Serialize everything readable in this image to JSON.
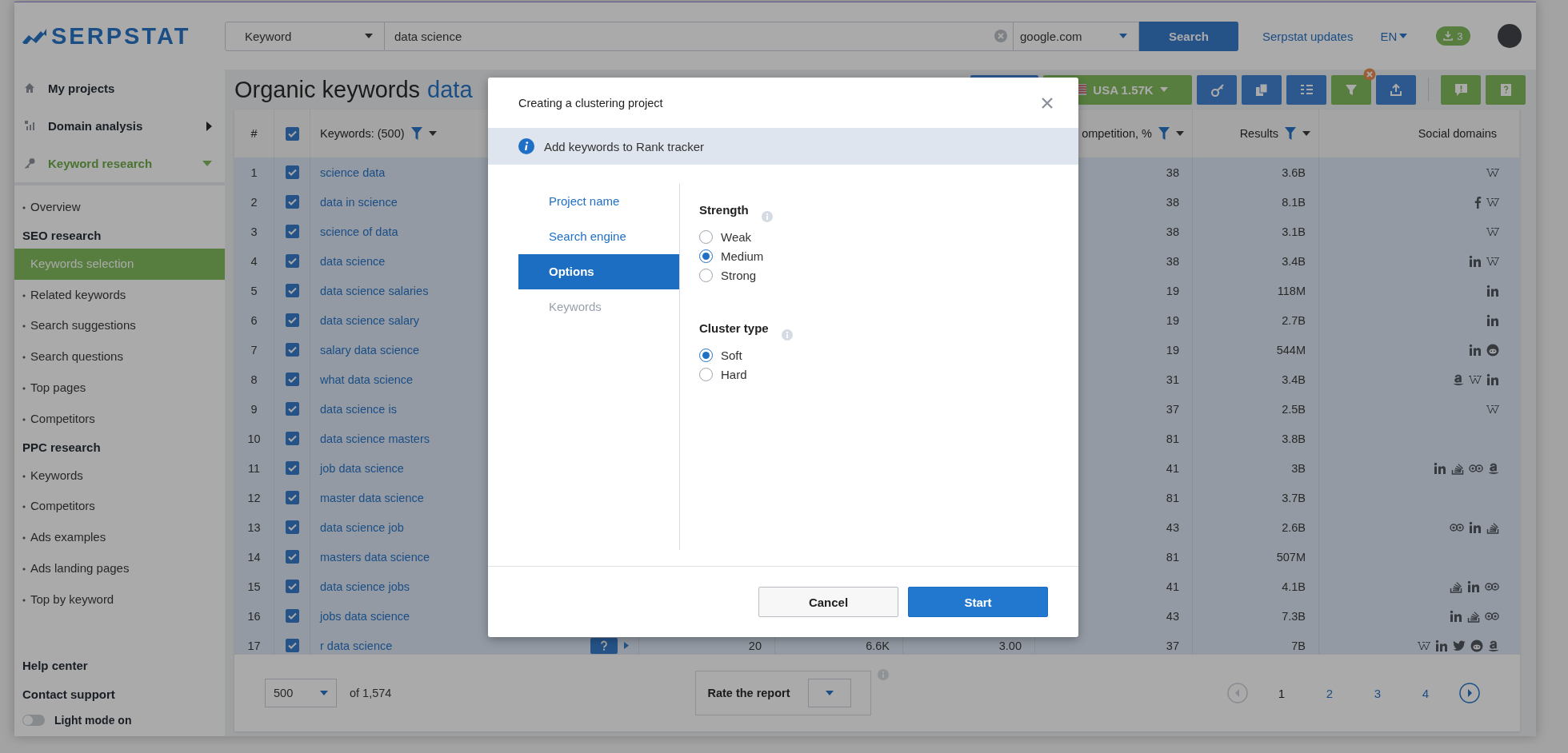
{
  "header": {
    "logo": "SERPSTAT",
    "search_type": "Keyword",
    "query": "data science",
    "engine": "google.com",
    "search_button": "Search",
    "updates_link": "Serpstat updates",
    "language": "EN",
    "downloads": "3"
  },
  "sidebar": {
    "items": [
      {
        "label": "My projects",
        "kind": "link"
      },
      {
        "label": "Domain analysis",
        "kind": "menu",
        "expanded": false
      },
      {
        "label": "Keyword research",
        "kind": "menu",
        "expanded": true
      }
    ],
    "subitems": [
      {
        "label": "Overview",
        "kind": "link",
        "selected": false
      },
      {
        "label": "SEO research",
        "kind": "heading"
      },
      {
        "label": "Keywords selection",
        "kind": "link",
        "selected": true
      },
      {
        "label": "Related keywords",
        "kind": "link",
        "selected": false
      },
      {
        "label": "Search suggestions",
        "kind": "link",
        "selected": false
      },
      {
        "label": "Search questions",
        "kind": "link",
        "selected": false
      },
      {
        "label": "Top pages",
        "kind": "link",
        "selected": false
      },
      {
        "label": "Competitors",
        "kind": "link",
        "selected": false
      },
      {
        "label": "PPC research",
        "kind": "heading"
      },
      {
        "label": "Keywords",
        "kind": "link",
        "selected": false
      },
      {
        "label": "Competitors",
        "kind": "link",
        "selected": false
      },
      {
        "label": "Ads examples",
        "kind": "link",
        "selected": false
      },
      {
        "label": "Ads landing pages",
        "kind": "link",
        "selected": false
      },
      {
        "label": "Top by keyword",
        "kind": "link",
        "selected": false
      }
    ],
    "footer_links": [
      "Help center",
      "Contact support"
    ],
    "toggle": {
      "label": "Light mode on",
      "on": false
    }
  },
  "page": {
    "title": "Organic keywords",
    "query": "data"
  },
  "toolbar": [
    {
      "kind": "plain"
    },
    {
      "kind": "country",
      "label": "USA 1.57K"
    },
    {
      "kind": "key"
    },
    {
      "kind": "copy"
    },
    {
      "kind": "columns"
    },
    {
      "kind": "filter",
      "active": true
    },
    {
      "kind": "export"
    },
    {
      "kind": "feedback"
    },
    {
      "kind": "help"
    }
  ],
  "table": {
    "header_checked": true,
    "columns": [
      {
        "label": "#",
        "filter": false
      },
      {
        "label": "Keywords: (500)",
        "filter": true
      },
      {
        "label": "ompetition, %",
        "filter": true
      },
      {
        "label": "Results",
        "filter": true
      },
      {
        "label": "Social domains",
        "filter": false
      }
    ],
    "rows": [
      {
        "num": "1",
        "checked": true,
        "keyword": "science data",
        "competition": "38",
        "results": "3.6B",
        "social": [
          {
            "kind": "wikipedia"
          }
        ]
      },
      {
        "num": "2",
        "checked": true,
        "keyword": "data in science",
        "competition": "38",
        "results": "8.1B",
        "social": [
          {
            "kind": "facebook"
          },
          {
            "kind": "wikipedia"
          }
        ]
      },
      {
        "num": "3",
        "checked": true,
        "keyword": "science of data",
        "competition": "38",
        "results": "3.1B",
        "social": [
          {
            "kind": "wikipedia"
          }
        ]
      },
      {
        "num": "4",
        "checked": true,
        "keyword": "data science",
        "competition": "38",
        "results": "3.4B",
        "social": [
          {
            "kind": "linkedin"
          },
          {
            "kind": "wikipedia"
          }
        ]
      },
      {
        "num": "5",
        "checked": true,
        "keyword": "data science salaries",
        "competition": "19",
        "results": "118M",
        "social": [
          {
            "kind": "linkedin"
          }
        ]
      },
      {
        "num": "6",
        "checked": true,
        "keyword": "data science salary",
        "competition": "19",
        "results": "2.7B",
        "social": [
          {
            "kind": "linkedin"
          }
        ]
      },
      {
        "num": "7",
        "checked": true,
        "keyword": "salary data science",
        "competition": "19",
        "results": "544M",
        "social": [
          {
            "kind": "linkedin"
          },
          {
            "kind": "reddit"
          }
        ]
      },
      {
        "num": "8",
        "checked": true,
        "keyword": "what data science",
        "competition": "31",
        "results": "3.4B",
        "social": [
          {
            "kind": "amazon"
          },
          {
            "kind": "wikipedia"
          },
          {
            "kind": "linkedin"
          }
        ]
      },
      {
        "num": "9",
        "checked": true,
        "keyword": "data science is",
        "competition": "37",
        "results": "2.5B",
        "social": [
          {
            "kind": "wikipedia"
          }
        ]
      },
      {
        "num": "10",
        "checked": true,
        "keyword": "data science masters",
        "competition": "81",
        "results": "3.8B"
      },
      {
        "num": "11",
        "checked": true,
        "keyword": "job data science",
        "competition": "41",
        "results": "3B",
        "social": [
          {
            "kind": "linkedin"
          },
          {
            "kind": "stack"
          },
          {
            "kind": "tripadvisor"
          },
          {
            "kind": "amazon"
          }
        ]
      },
      {
        "num": "12",
        "checked": true,
        "keyword": "master data science",
        "competition": "81",
        "results": "3.7B"
      },
      {
        "num": "13",
        "checked": true,
        "keyword": "data science job",
        "competition": "43",
        "results": "2.6B",
        "social": [
          {
            "kind": "tripadvisor"
          },
          {
            "kind": "linkedin"
          },
          {
            "kind": "stack"
          }
        ]
      },
      {
        "num": "14",
        "checked": true,
        "keyword": "masters data science",
        "competition": "81",
        "results": "507M"
      },
      {
        "num": "15",
        "checked": true,
        "keyword": "data science jobs",
        "competition": "41",
        "results": "4.1B",
        "social": [
          {
            "kind": "stack"
          },
          {
            "kind": "linkedin"
          },
          {
            "kind": "tripadvisor"
          }
        ]
      },
      {
        "num": "16",
        "checked": true,
        "keyword": "jobs data science",
        "competition": "43",
        "results": "7.3B",
        "social": [
          {
            "kind": "linkedin"
          },
          {
            "kind": "stack"
          },
          {
            "kind": "tripadvisor"
          }
        ]
      },
      {
        "num": "17",
        "checked": true,
        "keyword": "r data science",
        "help_badge": true,
        "column_4": "20",
        "column_5": "6.6K",
        "column_6": "3.00",
        "competition": "37",
        "results": "7B",
        "social": [
          {
            "kind": "wikipedia"
          },
          {
            "kind": "linkedin"
          },
          {
            "kind": "twitter"
          },
          {
            "kind": "reddit"
          },
          {
            "kind": "amazon"
          }
        ]
      }
    ]
  },
  "footer": {
    "per_page": "500",
    "total": "of 1,574",
    "rate_label": "Rate the report",
    "pages": [
      {
        "label": "1",
        "selected": true
      },
      {
        "label": "2",
        "selected": false
      },
      {
        "label": "3",
        "selected": false
      },
      {
        "label": "4",
        "selected": false
      }
    ]
  },
  "modal": {
    "title": "Creating a clustering project",
    "info": "Add keywords to Rank tracker",
    "steps": [
      {
        "label": "Project name",
        "selected": false,
        "disabled": false
      },
      {
        "label": "Search engine",
        "selected": false,
        "disabled": false
      },
      {
        "label": "Options",
        "selected": true,
        "disabled": false
      },
      {
        "label": "Keywords",
        "selected": false,
        "disabled": true
      }
    ],
    "groups": [
      {
        "title": "Strength",
        "options": [
          {
            "label": "Weak",
            "selected": false
          },
          {
            "label": "Medium",
            "selected": true
          },
          {
            "label": "Strong",
            "selected": false
          }
        ]
      },
      {
        "title": "Cluster type",
        "options": [
          {
            "label": "Soft",
            "selected": true
          },
          {
            "label": "Hard",
            "selected": false
          }
        ]
      }
    ],
    "buttons": [
      {
        "label": "Cancel",
        "kind": "secondary"
      },
      {
        "label": "Start",
        "kind": "primary"
      }
    ]
  }
}
